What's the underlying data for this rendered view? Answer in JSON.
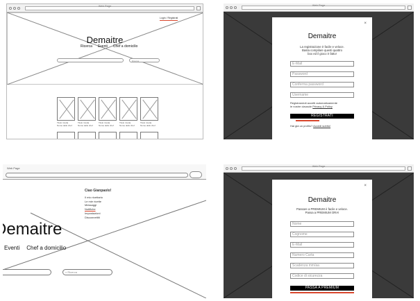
{
  "panel1": {
    "window_title": "Web Page",
    "top_link": "Login / Registrati",
    "brand": "Demaitre",
    "nav": [
      "Ricerca",
      "Eventi",
      "Chef a domicilio"
    ],
    "search_placeholder": "Ricerca",
    "cards": [
      {
        "title": "Titolo ricetta",
        "meta": "Nome dello chef"
      },
      {
        "title": "Titolo ricetta",
        "meta": "Nome dello chef"
      },
      {
        "title": "Titolo ricetta",
        "meta": "Nome dello chef"
      },
      {
        "title": "Titolo ricetta",
        "meta": "Nome dello chef"
      },
      {
        "title": "Titolo ricetta",
        "meta": "Nome dello chef"
      }
    ]
  },
  "panel2": {
    "window_title": "Web Page",
    "close": "×",
    "brand": "Demaitre",
    "intro": [
      "La registrazione è facile e veloce.",
      "Basta compilare questi quattro",
      "box ed il gioco è fatto!"
    ],
    "fields": [
      "E-Mail",
      "Password",
      "Conferma password",
      "Username"
    ],
    "consent_line1": "Registrandoti accetti automaticamente",
    "consent_line2_pre": "le nostre clausole ",
    "consent_link": "Privacy & Policy",
    "submit": "REGISTRATI",
    "login_prompt": "Hai già un profilo?",
    "login_link": "Accedi subito!"
  },
  "panel3": {
    "window_title": "Web Page",
    "brand": "Demaitre",
    "nav": [
      "Eventi",
      "Chef a domicilio"
    ],
    "search_placeholder": "Ricerca",
    "menu_title": "Ciao Gianpaolo!",
    "menu_items": [
      "Il mio ricettario",
      "Le mie ricette",
      "Messaggi",
      "Notifiche",
      "Impostazioni",
      "Disconnettiti"
    ]
  },
  "panel4": {
    "window_title": "Web Page",
    "close": "×",
    "brand": "Demaitre",
    "intro": [
      "Passare a PREMIUM è facile e veloce.",
      "Passa a PREMIUM ORA!"
    ],
    "fields": [
      "Nome",
      "Cognome",
      "E-Mail",
      "Numero Carta",
      "Scadenza mm/aa",
      "Codice di sicurezza"
    ],
    "submit": "PASSA A PREMIUM"
  }
}
